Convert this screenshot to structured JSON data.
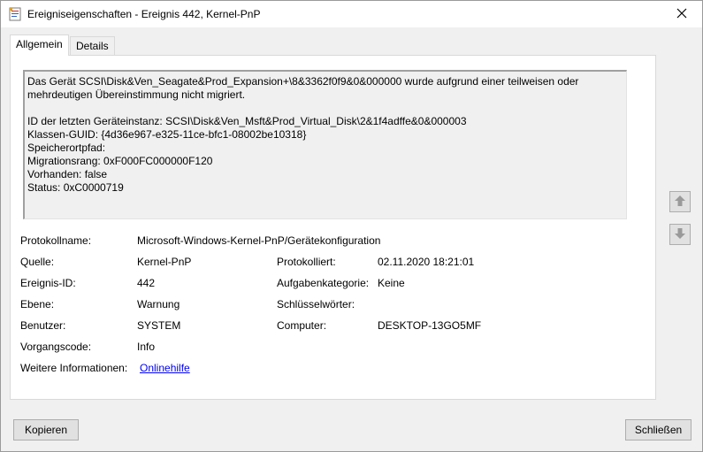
{
  "window": {
    "title": "Ereigniseigenschaften - Ereignis 442, Kernel-PnP"
  },
  "tabs": [
    {
      "label": "Allgemein",
      "active": true
    },
    {
      "label": "Details",
      "active": false
    }
  ],
  "description": {
    "lines": [
      "Das Gerät SCSI\\Disk&Ven_Seagate&Prod_Expansion+\\8&3362f0f9&0&000000 wurde aufgrund einer teilweisen oder",
      "mehrdeutigen Übereinstimmung nicht migriert.",
      "",
      "ID der letzten Geräteinstanz: SCSI\\Disk&Ven_Msft&Prod_Virtual_Disk\\2&1f4adffe&0&000003",
      "Klassen-GUID: {4d36e967-e325-11ce-bfc1-08002be10318}",
      "Speicherortpfad:",
      "Migrationsrang: 0xF000FC000000F120",
      "Vorhanden: false",
      "Status: 0xC0000719"
    ]
  },
  "fields": {
    "protokollname": {
      "label": "Protokollname:",
      "value": "Microsoft-Windows-Kernel-PnP/Gerätekonfiguration"
    },
    "quelle": {
      "label": "Quelle:",
      "value": "Kernel-PnP"
    },
    "protokolliert": {
      "label": "Protokolliert:",
      "value": "02.11.2020 18:21:01"
    },
    "ereignis_id": {
      "label": "Ereignis-ID:",
      "value": "442"
    },
    "aufgabenkategorie": {
      "label": "Aufgabenkategorie:",
      "value": "Keine"
    },
    "ebene": {
      "label": "Ebene:",
      "value": "Warnung"
    },
    "schluesselwoerter": {
      "label": "Schlüsselwörter:",
      "value": ""
    },
    "benutzer": {
      "label": "Benutzer:",
      "value": "SYSTEM"
    },
    "computer": {
      "label": "Computer:",
      "value": "DESKTOP-13GO5MF"
    },
    "vorgangscode": {
      "label": "Vorgangscode:",
      "value": "Info"
    },
    "weitere_informationen": {
      "label": "Weitere Informationen:",
      "value": "Onlinehilfe"
    }
  },
  "buttons": {
    "copy": "Kopieren",
    "close": "Schließen"
  },
  "icons": {
    "window": "event-properties-icon",
    "close": "close-icon",
    "up": "arrow-up-icon",
    "down": "arrow-down-icon"
  },
  "colors": {
    "link": "#0000ee",
    "textbox_bg": "#f0f0f0",
    "window_bg": "#f0f0f0"
  }
}
